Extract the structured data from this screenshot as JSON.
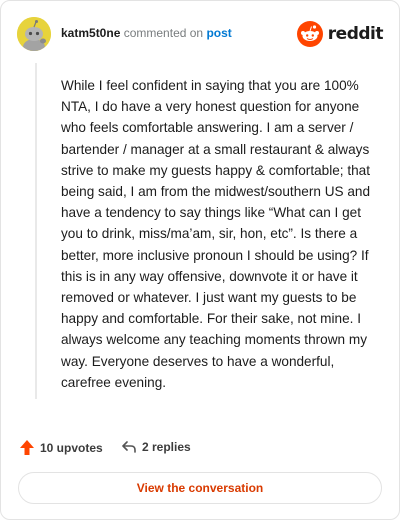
{
  "header": {
    "username": "katm5t0ne",
    "action_text": "commented on",
    "post_link": "post",
    "brand": "reddit"
  },
  "comment": {
    "body": "While I feel confident in saying that you are 100% NTA, I do have a very honest question for anyone who feels comfortable answering. I am a server / bartender / manager at a small restaurant & always strive to make my guests happy & comfortable; that being said, I am from the midwest/southern US and have a tendency to say things like “What can I get you to drink, miss/ma’am, sir, hon, etc”. Is there a better, more inclusive pronoun I should be using? If this is in any way offensive, downvote it or have it removed or whatever. I just want my guests to be happy and comfortable. For their sake, not mine. I always welcome any teaching moments thrown my way. Everyone deserves to have a wonderful, carefree evening."
  },
  "footer": {
    "upvotes": "10 upvotes",
    "replies": "2 replies"
  },
  "cta": {
    "label": "View the conversation"
  },
  "colors": {
    "accent": "#ff4500",
    "cta_text": "#d93a00",
    "link": "#0079d3",
    "avatar_bg": "#e7d33c"
  },
  "icons": {
    "avatar": "snoo-avatar-icon",
    "logo": "reddit-logo-icon",
    "upvote": "upvote-arrow-icon",
    "reply": "reply-arrow-icon"
  }
}
